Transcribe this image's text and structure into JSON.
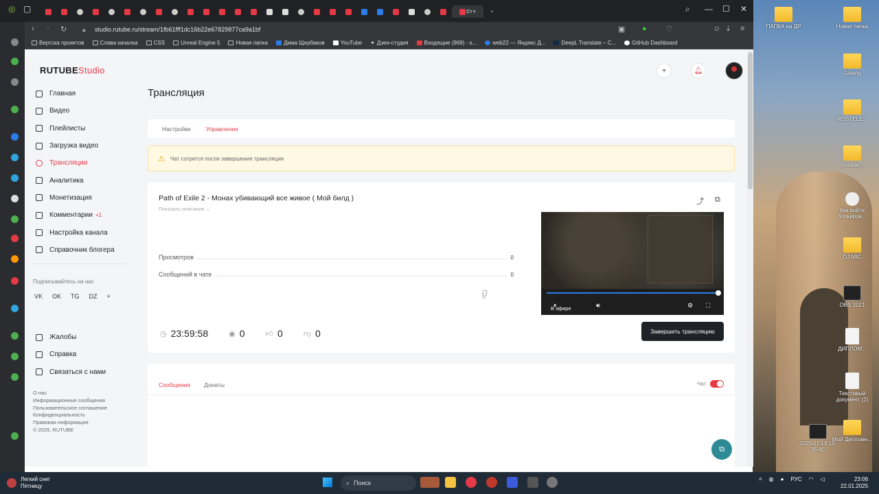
{
  "browser": {
    "url": "studio.rutube.ru/stream/1fb61fff1dc16b22e67829877ca9a1bf",
    "active_tab": "Ст",
    "bookmarks": [
      "Вертска проектов",
      "Слава качалка",
      "CSS",
      "Unreal Engine 5",
      "Новая папка",
      "Дима Щербаков",
      "YouTube",
      "Дзен-студия",
      "Входящие (969) - s...",
      "web22 — Яндекс Д...",
      "DeepL Translate – C...",
      "GitHub Dashboard"
    ]
  },
  "app": {
    "logo_main": "RUTUBE",
    "logo_suffix": "Studio",
    "sidebar": [
      {
        "label": "Главная",
        "icon": "home-icon"
      },
      {
        "label": "Видео",
        "icon": "video-icon"
      },
      {
        "label": "Плейлисты",
        "icon": "playlist-icon"
      },
      {
        "label": "Загрузка видео",
        "icon": "upload-icon"
      },
      {
        "label": "Трансляции",
        "icon": "broadcast-icon",
        "active": true
      },
      {
        "label": "Аналитика",
        "icon": "analytics-icon"
      },
      {
        "label": "Монетизация",
        "icon": "monetization-icon"
      },
      {
        "label": "Комментарии",
        "icon": "comments-icon",
        "badge": "+1"
      },
      {
        "label": "Настройка канала",
        "icon": "settings-icon"
      },
      {
        "label": "Справочник блогера",
        "icon": "guide-icon"
      }
    ],
    "subscribe_label": "Подписывайтесь на нас",
    "socials": [
      "VK",
      "OK",
      "TG",
      "DZ",
      "+"
    ],
    "sidebar_bottom": [
      {
        "label": "Жалобы",
        "icon": "flag-icon"
      },
      {
        "label": "Справка",
        "icon": "help-icon"
      },
      {
        "label": "Связаться с нами",
        "icon": "mail-icon"
      }
    ],
    "footer_links": [
      "О нас",
      "Информационные сообщения",
      "Пользовательское соглашение",
      "Конфиденциальность",
      "Правовая информация",
      "© 2025, RUTUBE"
    ]
  },
  "page": {
    "title": "Трансляция",
    "tabs": [
      "Настройки",
      "Управление"
    ],
    "active_tab": "Управление",
    "warning": "Чат сотрется после завершения трансляции",
    "stream_title": "Path of Exile 2 - Монах убивающий все живое ( Мой билд )",
    "show_description": "Показать описание ⌄",
    "stats": [
      {
        "label": "Просмотров",
        "value": "0"
      },
      {
        "label": "Сообщений в чате",
        "value": "0"
      }
    ],
    "timer": "23:59:58",
    "viewers": "0",
    "likes": "0",
    "dislikes": "0",
    "live_label": "В эфире",
    "end_button": "Завершить трансляцию",
    "chat_tabs": [
      "Сообщения",
      "Донаты"
    ],
    "chat_toggle_label": "Чат",
    "chat_enabled": true
  },
  "desktop_icons": [
    "ПАПКА на ДР",
    "Новая папка",
    "Golang",
    "ROSTELE...",
    "Rostele...",
    "Как войти блокиров...",
    "DJ MIC",
    "OBS 2021",
    "ДИПЛОМ...",
    "Текстовый документ (2)",
    "2025-01-16 15-35-45",
    "Мой Дипломн..."
  ],
  "taskbar": {
    "weather_line1": "Легкий снег",
    "weather_line2": "Пятницу",
    "search_label": "Поиск",
    "lang": "РУС",
    "time": "23:06",
    "date": "22.01.2025"
  }
}
